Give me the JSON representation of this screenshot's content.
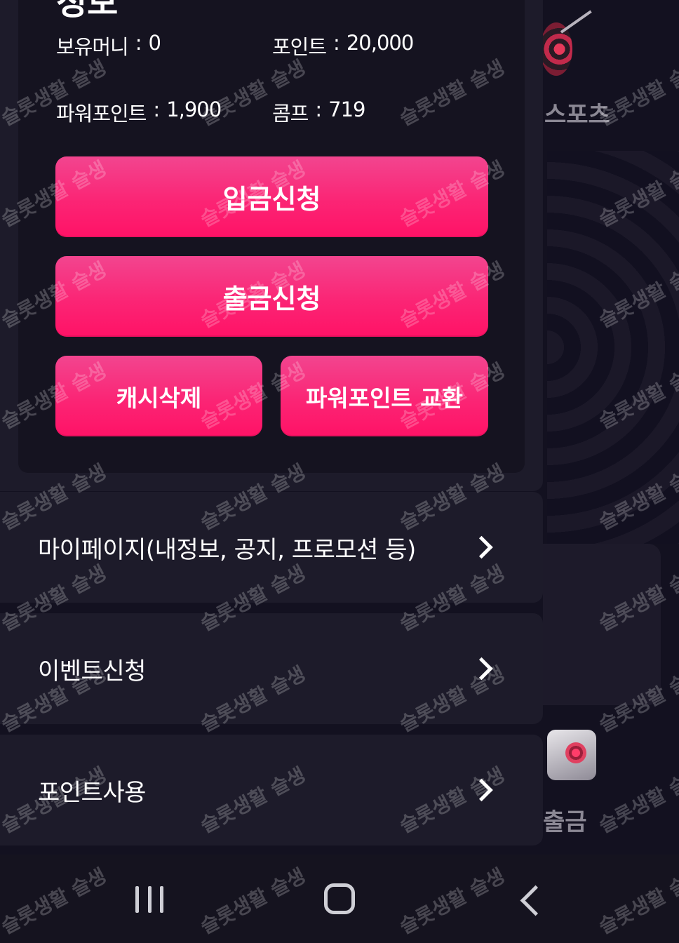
{
  "wallet": {
    "title_fragment": "정보",
    "money_label": "보유머니",
    "money_value": "0",
    "point_label": "포인트",
    "point_value": "20,000",
    "power_point_label": "파워포인트",
    "power_point_value": "1,900",
    "comp_label": "콤프",
    "comp_value": "719",
    "separator": ":"
  },
  "actions": {
    "deposit_label": "입금신청",
    "withdraw_label": "출금신청",
    "cash_delete_label": "캐시삭제",
    "power_exchange_label": "파워포인트 교환"
  },
  "menu": [
    {
      "label": "마이페이지(내정보, 공지, 프로모션 등)"
    },
    {
      "label": "이벤트신청"
    },
    {
      "label": "포인트사용"
    }
  ],
  "background": {
    "sports_label": "스포츠",
    "withdraw_label": "출금"
  },
  "watermark": "슬롯생활 슬생",
  "colors": {
    "accent": "#ff1a6e",
    "panel": "#1d1b2a",
    "card": "#151320"
  }
}
